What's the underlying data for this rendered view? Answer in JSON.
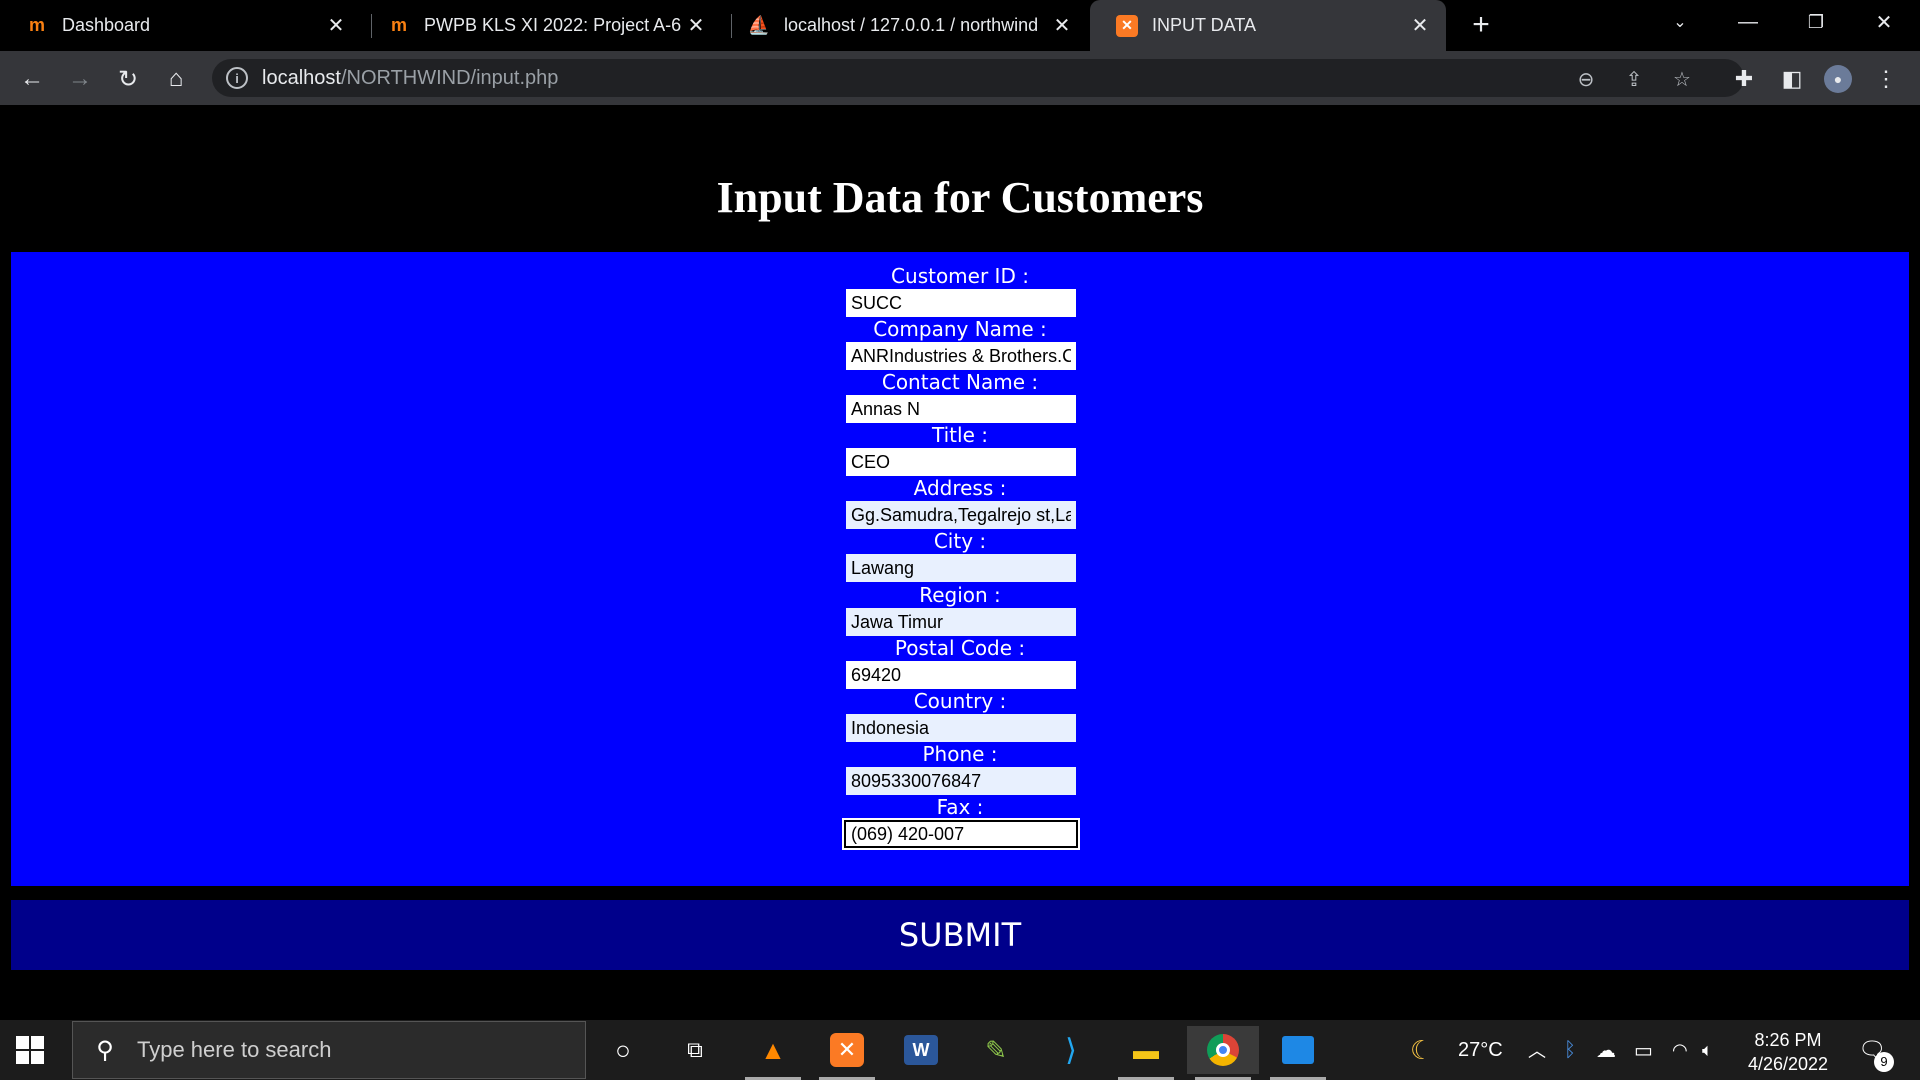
{
  "browser": {
    "tabs": [
      {
        "title": "Dashboard",
        "favicon": "moodle-icon",
        "active": false
      },
      {
        "title": "PWPB KLS XI 2022: Project A-6 - ",
        "favicon": "moodle-icon",
        "active": false
      },
      {
        "title": "localhost / 127.0.0.1 / northwind",
        "favicon": "phpmyadmin-icon",
        "active": false
      },
      {
        "title": "INPUT DATA",
        "favicon": "xampp-icon",
        "active": true
      }
    ],
    "url_host": "localhost",
    "url_path": "/NORTHWIND/input.php"
  },
  "page": {
    "title": "Input Data for Customers",
    "fields": [
      {
        "label": "Customer ID :",
        "value": "SUCC"
      },
      {
        "label": "Company Name :",
        "value": "ANRIndustries & Brothers.C"
      },
      {
        "label": "Contact Name :",
        "value": "Annas N"
      },
      {
        "label": "Title :",
        "value": "CEO"
      },
      {
        "label": "Address :",
        "value": "Gg.Samudra,Tegalrejo st,La"
      },
      {
        "label": "City :",
        "value": "Lawang"
      },
      {
        "label": "Region :",
        "value": "Jawa Timur"
      },
      {
        "label": "Postal Code :",
        "value": "69420"
      },
      {
        "label": "Country :",
        "value": "Indonesia"
      },
      {
        "label": "Phone :",
        "value": "8095330076847"
      },
      {
        "label": "Fax :",
        "value": "(069) 420-007"
      }
    ],
    "submit_label": "SUBMIT"
  },
  "taskbar": {
    "search_placeholder": "Type here to search",
    "weather": "27°C",
    "time": "8:26 PM",
    "date": "4/26/2022",
    "notifications": "9"
  },
  "colors": {
    "form_bg": "#0000ff",
    "submit_bg": "#00008b",
    "autofill_bg": "#e8f0fe"
  }
}
